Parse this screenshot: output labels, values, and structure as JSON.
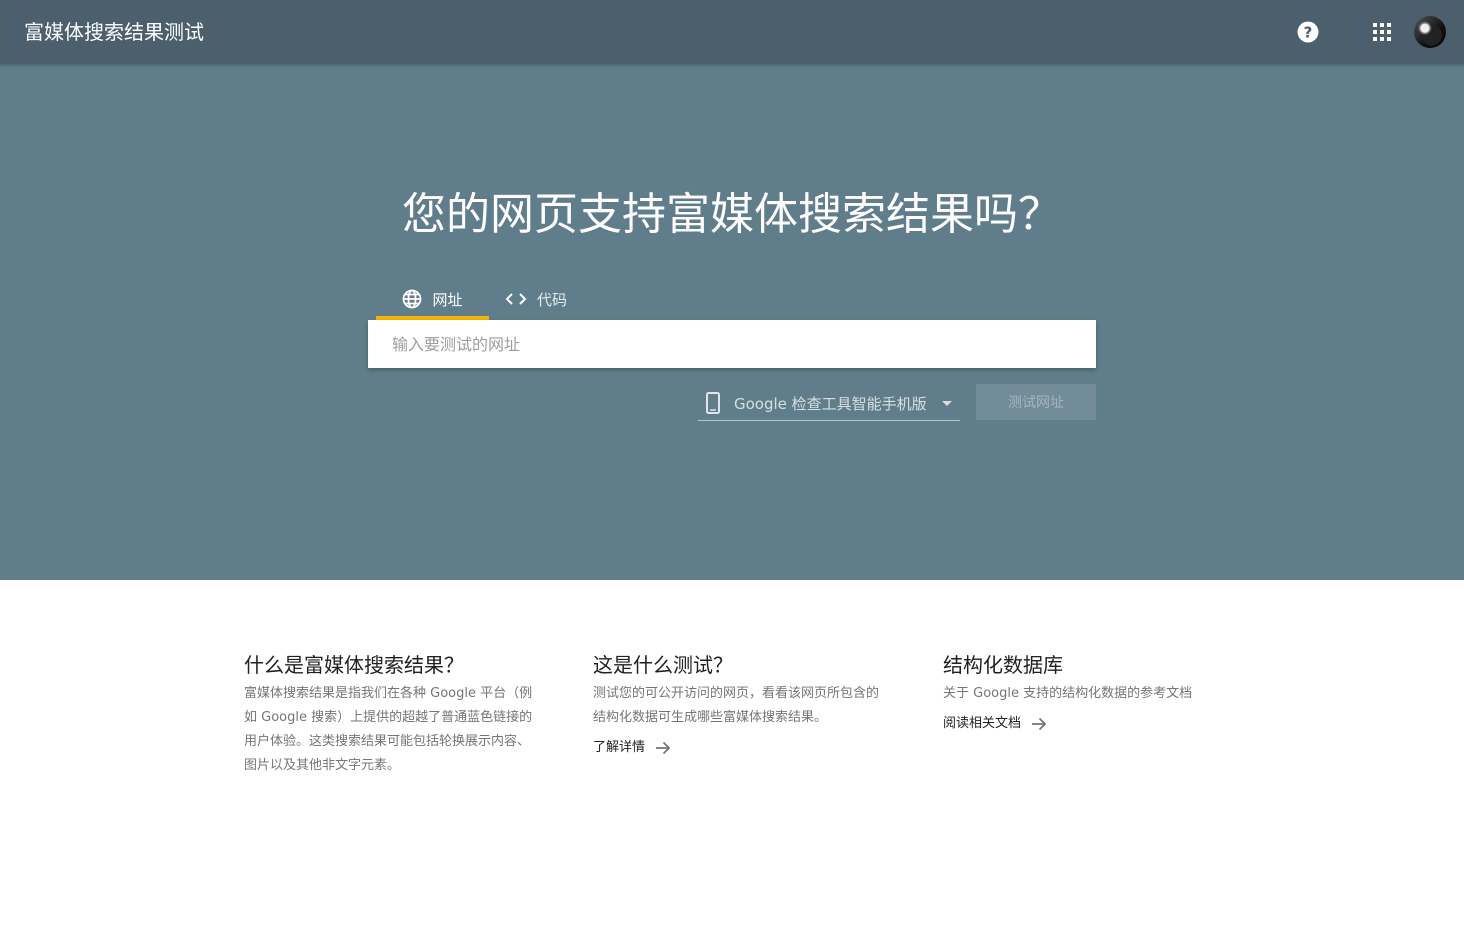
{
  "header": {
    "app_title": "富媒体搜索结果测试",
    "icons": [
      "help-icon",
      "apps-grid-icon",
      "user-avatar"
    ]
  },
  "hero": {
    "title": "您的网页支持富媒体搜索结果吗？",
    "tabs": [
      {
        "label": "网址",
        "icon": "globe-icon",
        "active": true
      },
      {
        "label": "代码",
        "icon": "code-brackets-icon",
        "active": false
      }
    ],
    "url_input": {
      "value": "",
      "placeholder": "输入要测试的网址"
    },
    "device_select": {
      "selected": "Google 检查工具智能手机版",
      "icon": "smartphone-icon"
    },
    "test_button_label": "测试网址"
  },
  "info": [
    {
      "title": "什么是富媒体搜索结果？",
      "body": "富媒体搜索结果是指我们在各种 Google 平台（例如 Google 搜索）上提供的超越了普通蓝色链接的用户体验。这类搜索结果可能包括轮换展示内容、图片以及其他非文字元素。",
      "link": ""
    },
    {
      "title": "这是什么测试？",
      "body": "测试您的可公开访问的网页，看看该网页所包含的结构化数据可生成哪些富媒体搜索结果。",
      "link": "了解详情"
    },
    {
      "title": "结构化数据库",
      "body": "关于 Google 支持的结构化数据的参考文档",
      "link": "阅读相关文档"
    }
  ],
  "colors": {
    "topbar": "#4b5f6c",
    "hero": "#607d8b",
    "tab_indicator": "#f4b400"
  }
}
